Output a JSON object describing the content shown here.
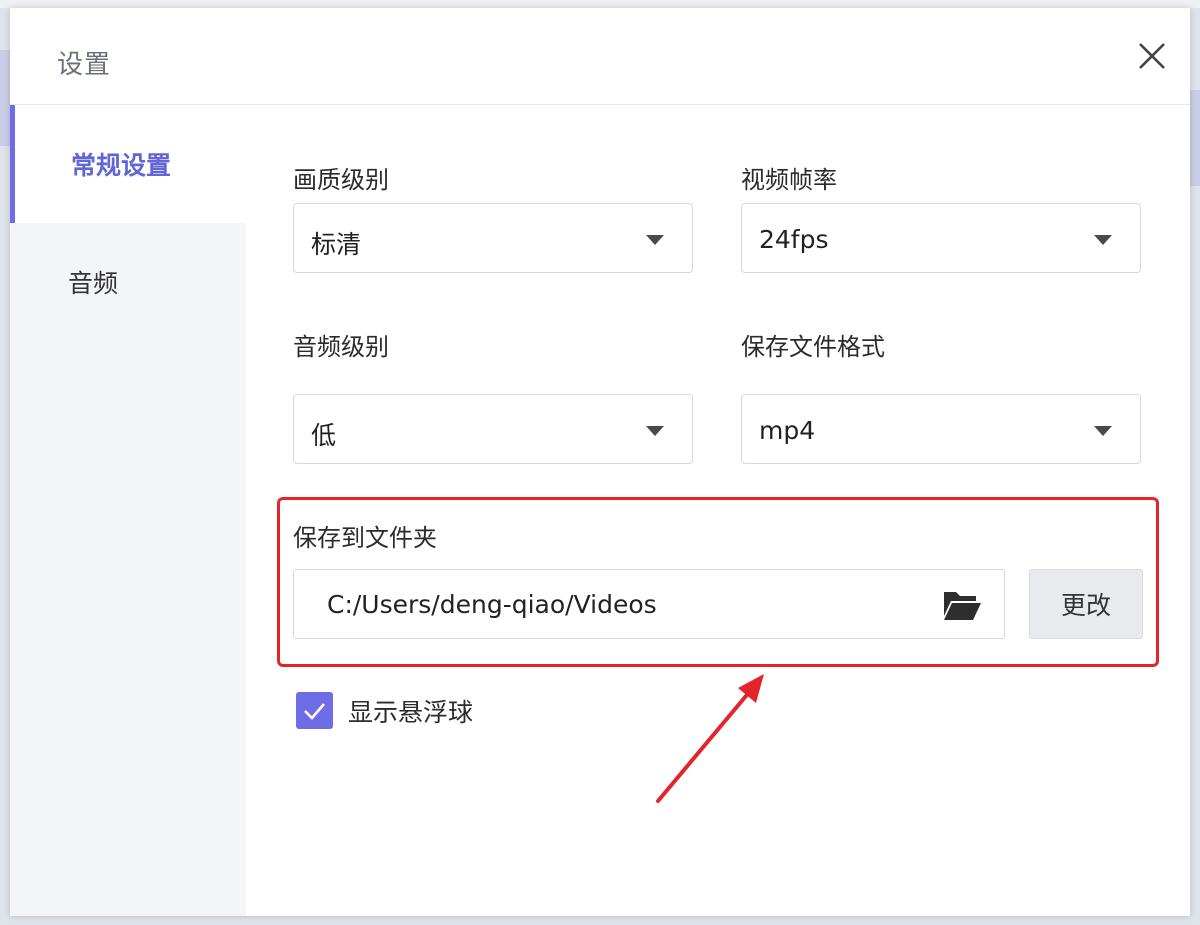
{
  "dialog": {
    "title": "设置"
  },
  "sidebar": {
    "items": [
      {
        "label": "常规设置",
        "active": true
      },
      {
        "label": "音频",
        "active": false
      }
    ]
  },
  "settings": {
    "video_quality": {
      "label": "画质级别",
      "value": "标清"
    },
    "frame_rate": {
      "label": "视频帧率",
      "value": "24fps"
    },
    "audio_quality": {
      "label": "音频级别",
      "value": "低"
    },
    "file_format": {
      "label": "保存文件格式",
      "value": "mp4"
    },
    "save_folder": {
      "label": "保存到文件夹",
      "path": "C:/Users/deng-qiao/Videos",
      "change_label": "更改"
    },
    "floating_ball": {
      "label": "显示悬浮球",
      "checked": true
    }
  },
  "colors": {
    "accent": "#6f6de6",
    "annotation": "#e3242b"
  }
}
